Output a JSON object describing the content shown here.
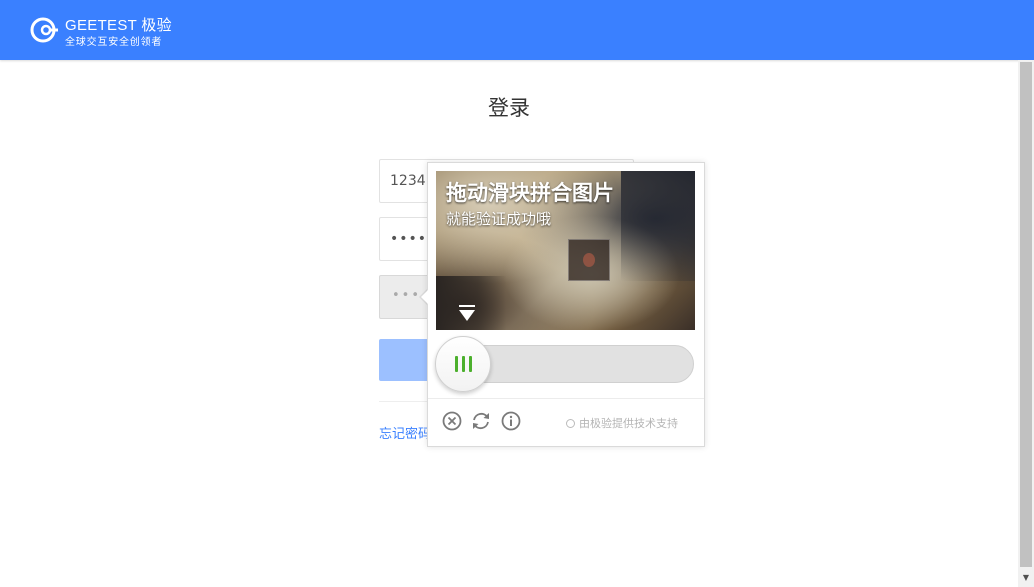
{
  "header": {
    "brand_name": "GEETEST 极验",
    "slogan": "全球交互安全创领者",
    "brand_color": "#3a80ff"
  },
  "login": {
    "title": "登录",
    "username_value": "1234",
    "password_mask": "•••••",
    "captcha_trigger_dots": "•••",
    "login_button_color": "#9cc0ff",
    "forgot_password_label": "忘记密码"
  },
  "captcha": {
    "image_title": "拖动滑块拼合图片",
    "image_subtitle": "就能验证成功哦",
    "slider_progress": 0,
    "accent_color": "#4cb02d",
    "footer_icons": [
      "close-icon",
      "refresh-icon",
      "info-icon"
    ],
    "provider_text": "由极验提供技术支持"
  }
}
